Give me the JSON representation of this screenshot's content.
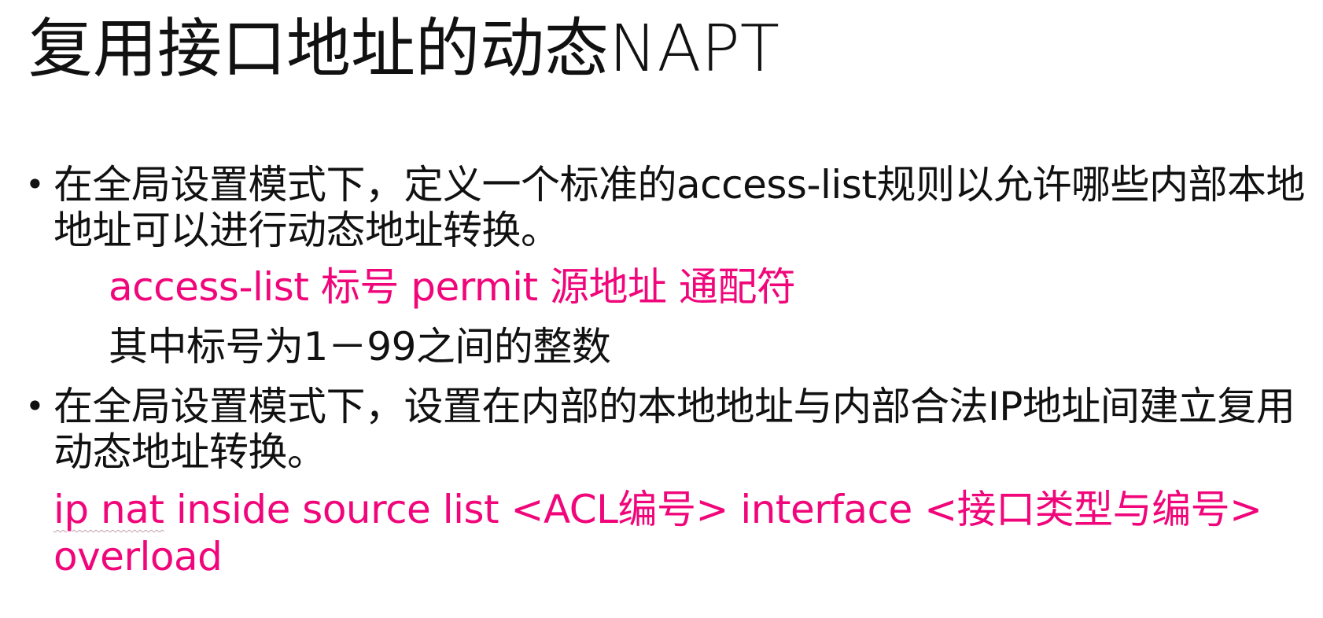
{
  "title": "复用接口地址的动态NAPT",
  "bullets": [
    {
      "marker": "•",
      "text": "在全局设置模式下，定义一个标准的access-list规则以允许哪些内部本地地址可以进行动态地址转换。"
    },
    {
      "marker": "•",
      "text": "在全局设置模式下，设置在内部的本地地址与内部合法IP地址间建立复用动态地址转换。"
    }
  ],
  "sub_lines": {
    "acl_command": "access-list 标号 permit 源地址 通配符",
    "acl_note": "其中标号为1－99之间的整数"
  },
  "nat_command": {
    "flagged_part": "ip nat",
    "rest": " inside source list <ACL编号> interface <接口类型与编号> overload"
  },
  "colors": {
    "accent_pink": "#f0067a",
    "text": "#111111",
    "background": "#ffffff"
  }
}
